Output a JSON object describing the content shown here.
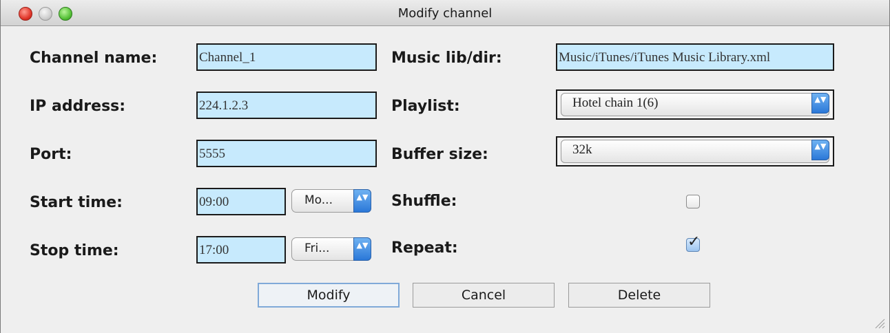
{
  "window": {
    "title": "Modify channel"
  },
  "form": {
    "channel_name": {
      "label": "Channel name:",
      "value": "Channel_1"
    },
    "ip_address": {
      "label": "IP address:",
      "value": "224.1.2.3"
    },
    "port": {
      "label": "Port:",
      "value": "5555"
    },
    "start_time": {
      "label": "Start time:",
      "value": "09:00",
      "day": "Mo..."
    },
    "stop_time": {
      "label": "Stop time:",
      "value": "17:00",
      "day": "Fri..."
    },
    "music_lib": {
      "label": "Music lib/dir:",
      "value": "Music/iTunes/iTunes Music Library.xml"
    },
    "playlist": {
      "label": "Playlist:",
      "selected": "Hotel chain 1(6)"
    },
    "buffer_size": {
      "label": "Buffer size:",
      "selected": "32k"
    },
    "shuffle": {
      "label": "Shuffle:",
      "checked": false
    },
    "repeat": {
      "label": "Repeat:",
      "checked": true
    }
  },
  "buttons": {
    "modify": "Modify",
    "cancel": "Cancel",
    "delete": "Delete"
  },
  "glyphs": {
    "arrows": "▲▼",
    "check": "✓"
  },
  "colors": {
    "field_bg": "#c7eafd",
    "window_bg": "#efefef"
  }
}
